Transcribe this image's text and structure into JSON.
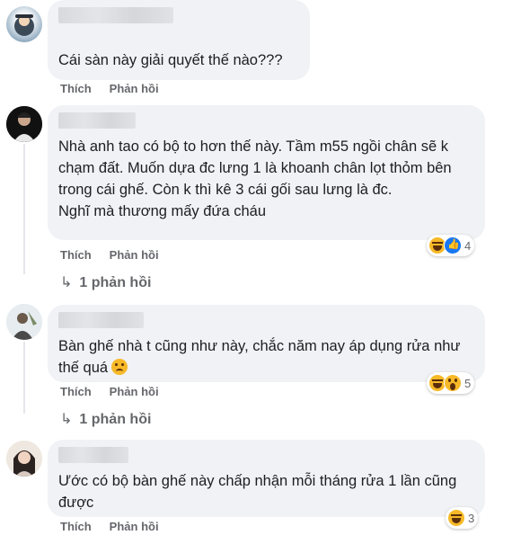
{
  "actions": {
    "like": "Thích",
    "reply": "Phản hồi"
  },
  "comments": [
    {
      "text": "Cái sàn này giải quyết thế nào???",
      "reactions": [],
      "reaction_count": "",
      "replies_label": ""
    },
    {
      "text": "Nhà anh tao có bộ to hơn thế này. Tầm m55 ngồi chân sẽ k chạm đất. Muốn dựa đc lưng 1 là khoanh chân lọt thỏm bên trong cái ghế. Còn k thì kê 3 cái gối sau lưng là đc.\nNghĩ mà thương mấy đứa cháu",
      "reactions": [
        "haha",
        "like"
      ],
      "reaction_count": "4",
      "replies_label": "1 phản hồi"
    },
    {
      "text": "Bàn ghế nhà t cũng như này, chắc năm nay áp dụng rửa như thế quá",
      "reactions": [
        "haha",
        "wow"
      ],
      "reaction_count": "5",
      "replies_label": "1 phản hồi"
    },
    {
      "text": "Ước có bộ bàn ghế này chấp nhận mỗi tháng rửa 1 lần cũng được",
      "reactions": [
        "haha"
      ],
      "reaction_count": "3",
      "replies_label": ""
    }
  ],
  "icons": {
    "reply_arrow": "reply-arrow-icon",
    "sad_emoji": "crying-emoji-icon"
  }
}
